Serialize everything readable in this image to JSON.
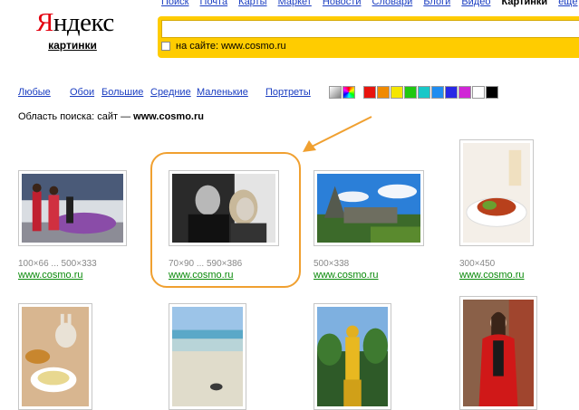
{
  "logo": {
    "text_first": "Я",
    "text_rest": "ндекс",
    "subtitle": "картинки"
  },
  "services": {
    "items": [
      "Поиск",
      "Почта",
      "Карты",
      "Маркет",
      "Новости",
      "Словари",
      "Блоги",
      "Видео",
      "Картинки"
    ],
    "more": "ещё"
  },
  "search": {
    "query": "",
    "site_checkbox_label": "на сайте: www.cosmo.ru"
  },
  "filters": {
    "size_links": [
      "Любые",
      "Обои",
      "Большие",
      "Средние",
      "Маленькие"
    ],
    "portraits": "Портреты",
    "colors": [
      "#c8c8c8",
      "multicolor",
      "#e8140e",
      "#f08a00",
      "#f5e600",
      "#20c810",
      "#19c8c8",
      "#1e8cf0",
      "#2828e6",
      "#d026d6",
      "#ffffff",
      "#000000"
    ]
  },
  "area": {
    "label": "Область поиска: сайт — ",
    "site": "www.cosmo.ru"
  },
  "results": [
    {
      "meta": "100×66 ... 500×333",
      "source": "www.cosmo.ru",
      "subject": "event-photo"
    },
    {
      "meta": "70×90 ... 590×386",
      "source": "www.cosmo.ru",
      "subject": "bw-couple"
    },
    {
      "meta": "500×338",
      "source": "www.cosmo.ru",
      "subject": "temple-landscape"
    },
    {
      "meta": "300×450",
      "source": "www.cosmo.ru",
      "subject": "food-plate"
    },
    {
      "subject": "bunny-food"
    },
    {
      "subject": "beach"
    },
    {
      "subject": "golden-buddha"
    },
    {
      "subject": "woman-red-coat"
    }
  ]
}
